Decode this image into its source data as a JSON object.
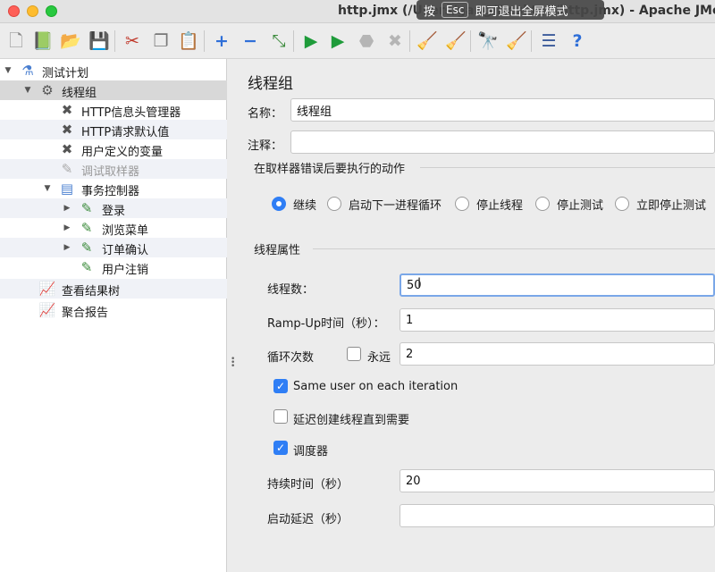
{
  "window": {
    "title": "http.jmx (/Users/gang/Desktop/http.jmx) - Apache JMeter",
    "fullscreen_tip": {
      "press": "按",
      "key": "Esc",
      "rest": "即可退出全屏模式"
    }
  },
  "toolbar": {
    "icons": [
      "new-icon",
      "templates-icon",
      "open-icon",
      "save-icon",
      "cut-icon",
      "copy-icon",
      "paste-icon",
      "expand-icon",
      "collapse-icon",
      "toggle-icon",
      "start-icon",
      "start-no-pause-icon",
      "stop-icon",
      "shutdown-icon",
      "clear-icon",
      "clear-all-icon",
      "search-icon",
      "reset-search-icon",
      "function-helper-icon",
      "help-icon"
    ]
  },
  "tree": {
    "items": [
      {
        "label": "测试计划"
      },
      {
        "label": "线程组"
      },
      {
        "label": "HTTP信息头管理器"
      },
      {
        "label": "HTTP请求默认值"
      },
      {
        "label": "用户定义的变量"
      },
      {
        "label": "调试取样器"
      },
      {
        "label": "事务控制器"
      },
      {
        "label": "登录"
      },
      {
        "label": "浏览菜单"
      },
      {
        "label": "订单确认"
      },
      {
        "label": "用户注销"
      },
      {
        "label": "查看结果树"
      },
      {
        "label": "聚合报告"
      }
    ]
  },
  "panel": {
    "title": "线程组",
    "name_label": "名称：",
    "name_value": "线程组",
    "comment_label": "注释：",
    "comment_value": "",
    "error_action": {
      "legend": "在取样器错误后要执行的动作",
      "options": [
        "继续",
        "启动下一进程循环",
        "停止线程",
        "停止测试",
        "立即停止测试"
      ],
      "selected": "继续"
    },
    "thread_props": {
      "legend": "线程属性",
      "threads_label": "线程数：",
      "threads_value": "50",
      "rampup_label": "Ramp-Up时间（秒）：",
      "rampup_value": "1",
      "loop_label": "循环次数",
      "forever_label": "永远",
      "forever_checked": false,
      "loop_value": "2",
      "same_user_label": "Same user on each iteration",
      "same_user_checked": true,
      "delay_label": "延迟创建线程直到需要",
      "delay_checked": false,
      "scheduler_label": "调度器",
      "scheduler_checked": true,
      "duration_label": "持续时间（秒）",
      "duration_value": "20",
      "startup_delay_label": "启动延迟（秒）",
      "startup_delay_value": ""
    }
  }
}
